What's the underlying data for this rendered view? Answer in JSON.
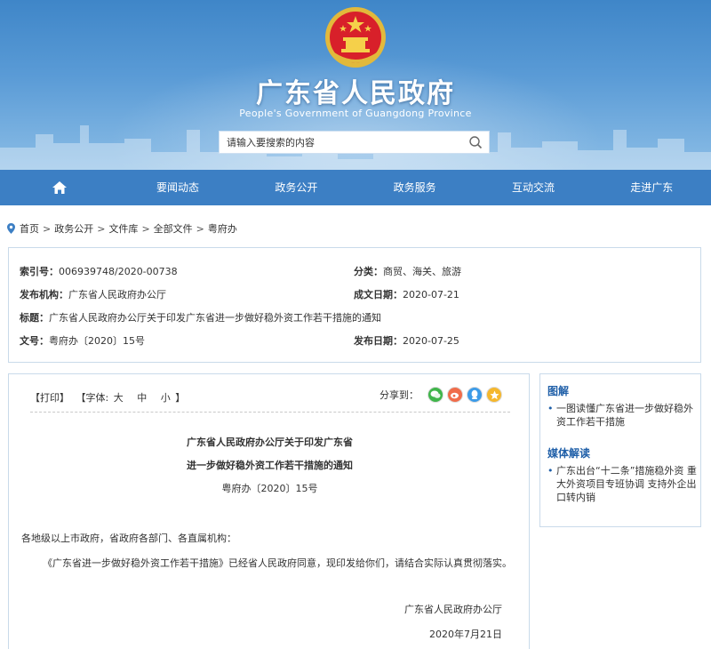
{
  "header": {
    "title": "广东省人民政府",
    "subtitle": "People's Government of Guangdong Province",
    "search_placeholder": "请输入要搜索的内容"
  },
  "nav": {
    "items": [
      "要闻动态",
      "政务公开",
      "政务服务",
      "互动交流",
      "走进广东"
    ]
  },
  "breadcrumb": [
    "首页",
    "政务公开",
    "文件库",
    "全部文件",
    "粤府办"
  ],
  "meta": {
    "index_label": "索引号：",
    "index_value": "006939748/2020-00738",
    "category_label": "分类：",
    "category_value": "商贸、海关、旅游",
    "publisher_label": "发布机构：",
    "publisher_value": "广东省人民政府办公厅",
    "date_written_label": "成文日期：",
    "date_written_value": "2020-07-21",
    "subject_label": "标题：",
    "subject_value": "广东省人民政府办公厅关于印发广东省进一步做好稳外资工作若干措施的通知",
    "doc_no_label": "文号：",
    "doc_no_value": "粤府办〔2020〕15号",
    "date_published_label": "发布日期：",
    "date_published_value": "2020-07-25"
  },
  "article": {
    "print": "【打印】",
    "font_label": "【字体:",
    "font_large": "大",
    "font_medium": "中",
    "font_small": "小",
    "font_close": "】",
    "share_label": "分享到：",
    "title_line1": "广东省人民政府办公厅关于印发广东省",
    "title_line2": "进一步做好稳外资工作若干措施的通知",
    "doc_no": "粤府办〔2020〕15号",
    "salutation": "各地级以上市政府，省政府各部门、各直属机构：",
    "body": "《广东省进一步做好稳外资工作若干措施》已经省人民政府同意，现印发给你们，请结合实际认真贯彻落实。",
    "signature": "广东省人民政府办公厅",
    "date": "2020年7月21日"
  },
  "sidebar": {
    "section1_title": "图解",
    "section1_items": [
      "一图读懂广东省进一步做好稳外资工作若干措施"
    ],
    "section2_title": "媒体解读",
    "section2_items": [
      "广东出台“十二条”措施稳外资 重大外资项目专班协调 支持外企出口转内销"
    ]
  },
  "colors": {
    "nav_bg": "#3c7fc4",
    "accent": "#1f5fa8",
    "border": "#c9daea"
  }
}
